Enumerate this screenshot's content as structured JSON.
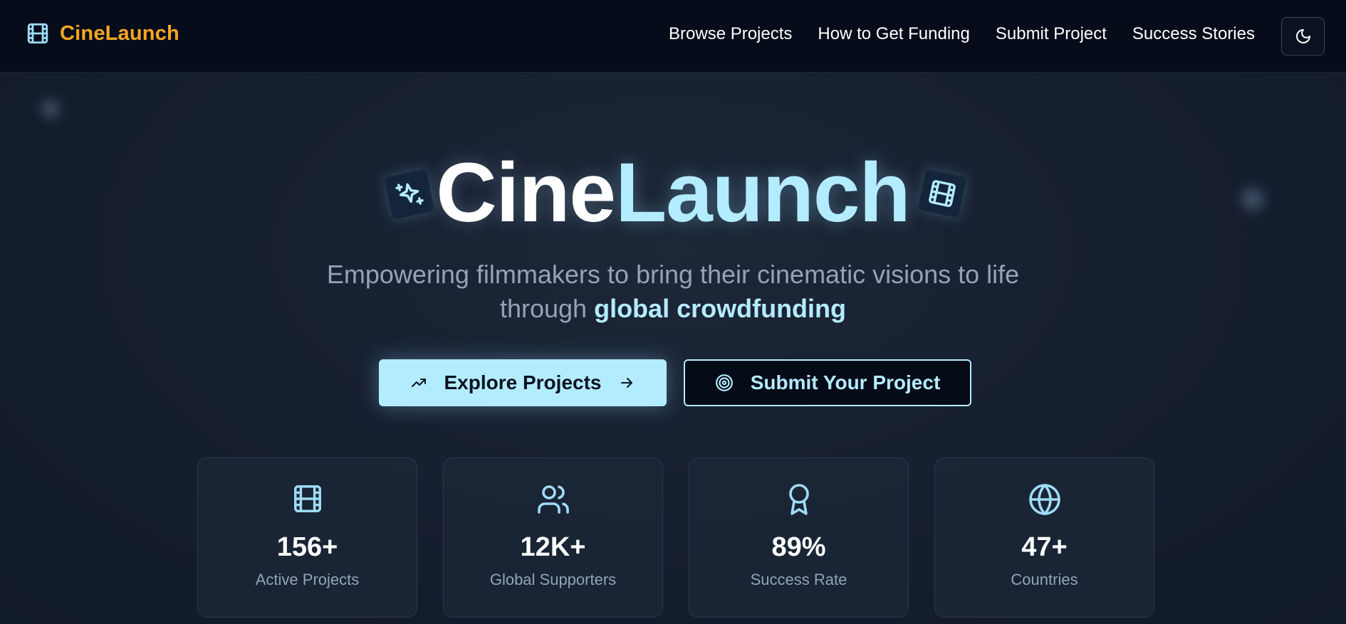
{
  "brand": {
    "name": "CineLaunch",
    "icon": "film-icon",
    "color": "#f5a623"
  },
  "nav": {
    "links": [
      "Browse Projects",
      "How to Get Funding",
      "Submit Project",
      "Success Stories"
    ],
    "theme_toggle_icon": "moon-icon"
  },
  "hero": {
    "title_part1": "Cine",
    "title_part2": "Launch",
    "subtitle_line1": "Empowering filmmakers to bring their cinematic visions to life",
    "subtitle_line2_prefix": "through ",
    "subtitle_highlight": "global crowdfunding",
    "accent_color": "#b4ecff"
  },
  "buttons": {
    "explore": {
      "label": "Explore Projects",
      "icon_left": "trending-up-icon",
      "icon_right": "arrow-right-icon"
    },
    "submit": {
      "label": "Submit Your Project",
      "icon_left": "target-icon"
    }
  },
  "stats": [
    {
      "value": "156+",
      "label": "Active Projects",
      "icon": "film-icon"
    },
    {
      "value": "12K+",
      "label": "Global Supporters",
      "icon": "users-icon"
    },
    {
      "value": "89%",
      "label": "Success Rate",
      "icon": "award-icon"
    },
    {
      "value": "47+",
      "label": "Countries",
      "icon": "globe-icon"
    }
  ]
}
